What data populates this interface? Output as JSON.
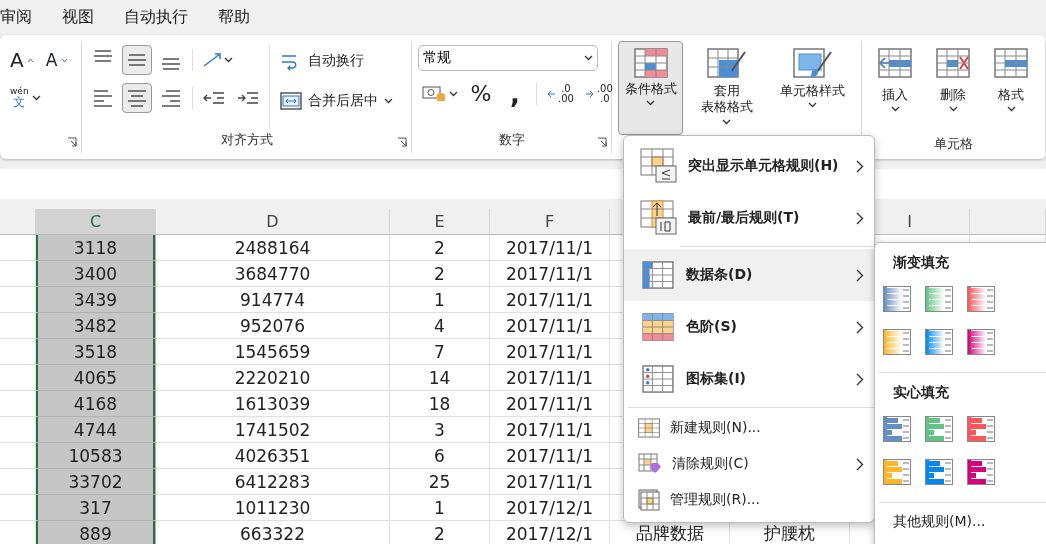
{
  "menu_tabs": [
    {
      "label": "审阅"
    },
    {
      "label": "视图"
    },
    {
      "label": "自动执行"
    },
    {
      "label": "帮助"
    }
  ],
  "ribbon": {
    "font": {
      "grow_label": "A",
      "shrink_label": "A",
      "phonetic_top": "wén",
      "phonetic_bottom": "文"
    },
    "alignment": {
      "label": "对齐方式",
      "vertical": [
        {
          "kind": "top",
          "selected": false
        },
        {
          "kind": "middle",
          "selected": true
        },
        {
          "kind": "bottom",
          "selected": false
        }
      ],
      "horizontal": [
        {
          "kind": "left",
          "selected": false
        },
        {
          "kind": "center",
          "selected": true
        },
        {
          "kind": "right",
          "selected": false
        }
      ],
      "wrap_text": "自动换行",
      "merge_center": "合并后居中"
    },
    "number": {
      "label": "数字",
      "format": "常规",
      "percent": "%",
      "comma": ",",
      "increase_decimal": {
        "top": ".0",
        "bottom": ".00"
      },
      "decrease_decimal": {
        "top": ".00",
        "bottom": ".0"
      }
    },
    "styles": [
      {
        "kind": "conditional",
        "lines": [
          "条件格式"
        ],
        "selected": true
      },
      {
        "kind": "table",
        "lines": [
          "套用",
          "表格格式"
        ],
        "selected": false
      },
      {
        "kind": "cell",
        "lines": [
          "单元格样式"
        ],
        "selected": false
      }
    ],
    "cells": {
      "label": "单元格",
      "buttons": [
        {
          "kind": "insert",
          "label": "插入"
        },
        {
          "kind": "delete",
          "label": "删除"
        },
        {
          "kind": "format",
          "label": "格式"
        }
      ]
    }
  },
  "sheet": {
    "columns": [
      {
        "label": "C",
        "selected": true
      },
      {
        "label": "D",
        "selected": false
      },
      {
        "label": "E",
        "selected": false
      },
      {
        "label": "F",
        "selected": false
      },
      {
        "label": "I",
        "selected": false
      }
    ],
    "rows": [
      {
        "cells": [
          "3118",
          "2488164",
          "2",
          "2017/11/1"
        ]
      },
      {
        "cells": [
          "3400",
          "3684770",
          "2",
          "2017/11/1"
        ]
      },
      {
        "cells": [
          "3439",
          "914774",
          "1",
          "2017/11/1"
        ]
      },
      {
        "cells": [
          "3482",
          "952076",
          "4",
          "2017/11/1"
        ]
      },
      {
        "cells": [
          "3518",
          "1545659",
          "7",
          "2017/11/1"
        ]
      },
      {
        "cells": [
          "4065",
          "2220210",
          "14",
          "2017/11/1"
        ]
      },
      {
        "cells": [
          "4168",
          "1613039",
          "18",
          "2017/11/1"
        ]
      },
      {
        "cells": [
          "4744",
          "1741502",
          "3",
          "2017/11/1"
        ]
      },
      {
        "cells": [
          "10583",
          "4026351",
          "6",
          "2017/11/1"
        ]
      },
      {
        "cells": [
          "33702",
          "6412283",
          "25",
          "2017/11/1"
        ]
      },
      {
        "cells": [
          "317",
          "1011230",
          "1",
          "2017/12/1"
        ]
      },
      {
        "cells": [
          "889",
          "663322",
          "2",
          "2017/12/1",
          "品牌数据",
          "护腰枕"
        ]
      }
    ]
  },
  "menu": {
    "items": [
      {
        "kind": "large",
        "label": "突出显示单元格规则(H)",
        "submenu": true,
        "selected": false
      },
      {
        "kind": "large",
        "label": "最前/最后规则(T)",
        "submenu": true,
        "selected": false
      },
      {
        "kind": "large",
        "label": "数据条(D)",
        "submenu": true,
        "selected": true
      },
      {
        "kind": "large",
        "label": "色阶(S)",
        "submenu": true,
        "selected": false
      },
      {
        "kind": "large",
        "label": "图标集(I)",
        "submenu": true,
        "selected": false
      },
      {
        "kind": "small",
        "label": "新建规则(N)...",
        "submenu": false,
        "selected": false
      },
      {
        "kind": "small",
        "label": "清除规则(C)",
        "submenu": true,
        "selected": false
      },
      {
        "kind": "small",
        "label": "管理规则(R)...",
        "submenu": false,
        "selected": false
      }
    ]
  },
  "submenu": {
    "sections": [
      {
        "title": "渐变填充",
        "kind": "gradient",
        "swatches": [
          {
            "color": "#638ec6"
          },
          {
            "color": "#63c384"
          },
          {
            "color": "#ff555a"
          },
          {
            "color": "#ffb628"
          },
          {
            "color": "#008aef"
          },
          {
            "color": "#d6007b"
          }
        ]
      },
      {
        "title": "实心填充",
        "kind": "solid",
        "swatches": [
          {
            "color": "#638ec6"
          },
          {
            "color": "#63c384"
          },
          {
            "color": "#ff555a"
          },
          {
            "color": "#ffb628"
          },
          {
            "color": "#008aef"
          },
          {
            "color": "#d6007b"
          }
        ]
      }
    ],
    "more": "其他规则(M)..."
  }
}
